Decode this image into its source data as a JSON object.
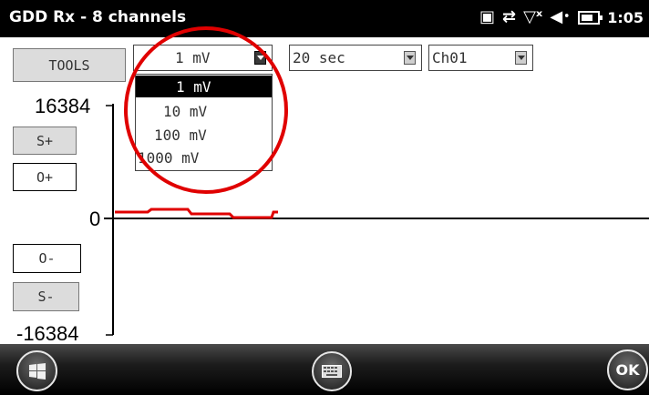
{
  "window": {
    "title": "GDD Rx - 8 channels",
    "clock": "1:05"
  },
  "status_icons": [
    "sim-icon",
    "sync-icon",
    "signal-off-icon",
    "volume-icon",
    "battery-icon"
  ],
  "toolbar": {
    "tools_label": "TOOLS",
    "scale_combo": {
      "selected": "1 mV",
      "options": [
        "1 mV",
        "10 mV",
        "100 mV",
        "1000 mV"
      ]
    },
    "time_combo": {
      "selected": "20 sec"
    },
    "channel_combo": {
      "selected": "Ch01"
    }
  },
  "side_buttons": {
    "scale_up": "S+",
    "offset_up": "O+",
    "offset_down": "O-",
    "scale_down": "S-"
  },
  "plot": {
    "y_max": "16384",
    "y_zero": "0",
    "y_min": "-16384",
    "trace_color": "#e00000"
  },
  "annotation": {
    "circle_color": "#e00000"
  },
  "taskbar": {
    "start_icon": "windows-start-icon",
    "keyboard_icon": "keyboard-icon",
    "ok_label": "OK"
  }
}
